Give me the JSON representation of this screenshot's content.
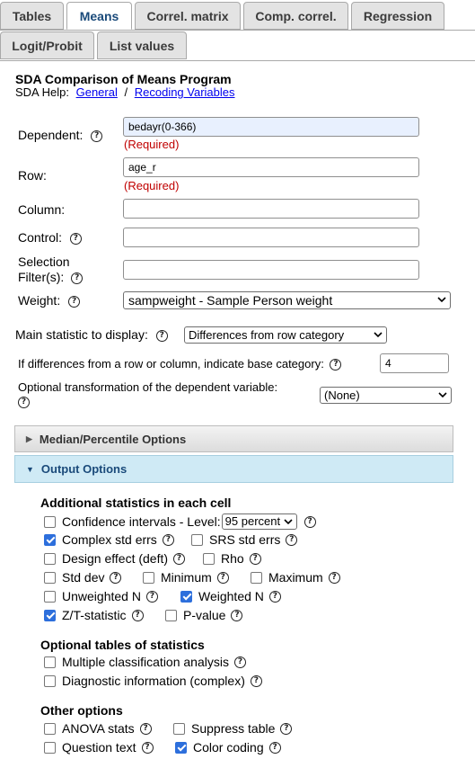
{
  "tabs": [
    {
      "label": "Tables",
      "active": false
    },
    {
      "label": "Means",
      "active": true
    },
    {
      "label": "Correl. matrix",
      "active": false
    },
    {
      "label": "Comp. correl.",
      "active": false
    },
    {
      "label": "Regression",
      "active": false
    },
    {
      "label": "Logit/Probit",
      "active": false
    },
    {
      "label": "List values",
      "active": false
    }
  ],
  "header": {
    "title": "SDA Comparison of Means Program",
    "help_prefix": "SDA Help:",
    "help_general": "General",
    "help_separator": "/",
    "help_recoding": "Recoding Variables"
  },
  "form": {
    "dependent": {
      "label": "Dependent:",
      "value": "bedayr(0-366)",
      "required": "(Required)"
    },
    "row": {
      "label": "Row:",
      "value": "age_r",
      "required": "(Required)"
    },
    "column": {
      "label": "Column:",
      "value": ""
    },
    "control": {
      "label": "Control:",
      "value": ""
    },
    "filter": {
      "label_line1": "Selection",
      "label_line2": "Filter(s):",
      "value": ""
    },
    "weight": {
      "label": "Weight:",
      "selected": "sampweight - Sample Person weight"
    },
    "main_stat": {
      "label": "Main statistic to display:",
      "selected": "Differences from row category"
    },
    "base_category": {
      "label": "If differences from a row or column, indicate base category:",
      "value": "4"
    },
    "transform": {
      "label": "Optional transformation of the dependent variable:",
      "selected": "(None)"
    }
  },
  "panels": {
    "median": "Median/Percentile Options",
    "output": "Output Options"
  },
  "output_options": {
    "cell_stats_heading": "Additional statistics in each cell",
    "ci_label": "Confidence intervals - Level:",
    "ci_level": "95 percent",
    "complex_std_errs": "Complex std errs",
    "srs_std_errs": "SRS std errs",
    "design_effect": "Design effect (deft)",
    "rho": "Rho",
    "std_dev": "Std dev",
    "minimum": "Minimum",
    "maximum": "Maximum",
    "unweighted_n": "Unweighted N",
    "weighted_n": "Weighted N",
    "z_t_statistic": "Z/T-statistic",
    "p_value": "P-value",
    "optional_tables_heading": "Optional tables of statistics",
    "mca": "Multiple classification analysis",
    "diagnostic": "Diagnostic information (complex)",
    "other_heading": "Other options",
    "anova": "ANOVA stats",
    "suppress_table": "Suppress table",
    "question_text": "Question text",
    "color_coding": "Color coding"
  },
  "colors": {
    "link": "#0000ee",
    "required": "#c00000",
    "checkbox_checked": "#2d6fdc",
    "active_panel": "#cfeaf5"
  }
}
